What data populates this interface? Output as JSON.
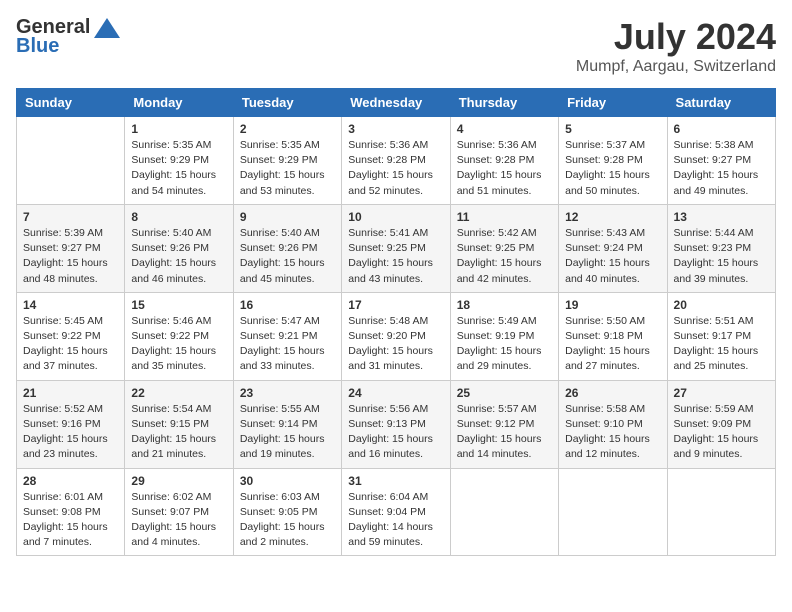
{
  "header": {
    "logo_general": "General",
    "logo_blue": "Blue",
    "month": "July 2024",
    "location": "Mumpf, Aargau, Switzerland"
  },
  "weekdays": [
    "Sunday",
    "Monday",
    "Tuesday",
    "Wednesday",
    "Thursday",
    "Friday",
    "Saturday"
  ],
  "weeks": [
    [
      {
        "day": "",
        "info": ""
      },
      {
        "day": "1",
        "info": "Sunrise: 5:35 AM\nSunset: 9:29 PM\nDaylight: 15 hours\nand 54 minutes."
      },
      {
        "day": "2",
        "info": "Sunrise: 5:35 AM\nSunset: 9:29 PM\nDaylight: 15 hours\nand 53 minutes."
      },
      {
        "day": "3",
        "info": "Sunrise: 5:36 AM\nSunset: 9:28 PM\nDaylight: 15 hours\nand 52 minutes."
      },
      {
        "day": "4",
        "info": "Sunrise: 5:36 AM\nSunset: 9:28 PM\nDaylight: 15 hours\nand 51 minutes."
      },
      {
        "day": "5",
        "info": "Sunrise: 5:37 AM\nSunset: 9:28 PM\nDaylight: 15 hours\nand 50 minutes."
      },
      {
        "day": "6",
        "info": "Sunrise: 5:38 AM\nSunset: 9:27 PM\nDaylight: 15 hours\nand 49 minutes."
      }
    ],
    [
      {
        "day": "7",
        "info": "Sunrise: 5:39 AM\nSunset: 9:27 PM\nDaylight: 15 hours\nand 48 minutes."
      },
      {
        "day": "8",
        "info": "Sunrise: 5:40 AM\nSunset: 9:26 PM\nDaylight: 15 hours\nand 46 minutes."
      },
      {
        "day": "9",
        "info": "Sunrise: 5:40 AM\nSunset: 9:26 PM\nDaylight: 15 hours\nand 45 minutes."
      },
      {
        "day": "10",
        "info": "Sunrise: 5:41 AM\nSunset: 9:25 PM\nDaylight: 15 hours\nand 43 minutes."
      },
      {
        "day": "11",
        "info": "Sunrise: 5:42 AM\nSunset: 9:25 PM\nDaylight: 15 hours\nand 42 minutes."
      },
      {
        "day": "12",
        "info": "Sunrise: 5:43 AM\nSunset: 9:24 PM\nDaylight: 15 hours\nand 40 minutes."
      },
      {
        "day": "13",
        "info": "Sunrise: 5:44 AM\nSunset: 9:23 PM\nDaylight: 15 hours\nand 39 minutes."
      }
    ],
    [
      {
        "day": "14",
        "info": "Sunrise: 5:45 AM\nSunset: 9:22 PM\nDaylight: 15 hours\nand 37 minutes."
      },
      {
        "day": "15",
        "info": "Sunrise: 5:46 AM\nSunset: 9:22 PM\nDaylight: 15 hours\nand 35 minutes."
      },
      {
        "day": "16",
        "info": "Sunrise: 5:47 AM\nSunset: 9:21 PM\nDaylight: 15 hours\nand 33 minutes."
      },
      {
        "day": "17",
        "info": "Sunrise: 5:48 AM\nSunset: 9:20 PM\nDaylight: 15 hours\nand 31 minutes."
      },
      {
        "day": "18",
        "info": "Sunrise: 5:49 AM\nSunset: 9:19 PM\nDaylight: 15 hours\nand 29 minutes."
      },
      {
        "day": "19",
        "info": "Sunrise: 5:50 AM\nSunset: 9:18 PM\nDaylight: 15 hours\nand 27 minutes."
      },
      {
        "day": "20",
        "info": "Sunrise: 5:51 AM\nSunset: 9:17 PM\nDaylight: 15 hours\nand 25 minutes."
      }
    ],
    [
      {
        "day": "21",
        "info": "Sunrise: 5:52 AM\nSunset: 9:16 PM\nDaylight: 15 hours\nand 23 minutes."
      },
      {
        "day": "22",
        "info": "Sunrise: 5:54 AM\nSunset: 9:15 PM\nDaylight: 15 hours\nand 21 minutes."
      },
      {
        "day": "23",
        "info": "Sunrise: 5:55 AM\nSunset: 9:14 PM\nDaylight: 15 hours\nand 19 minutes."
      },
      {
        "day": "24",
        "info": "Sunrise: 5:56 AM\nSunset: 9:13 PM\nDaylight: 15 hours\nand 16 minutes."
      },
      {
        "day": "25",
        "info": "Sunrise: 5:57 AM\nSunset: 9:12 PM\nDaylight: 15 hours\nand 14 minutes."
      },
      {
        "day": "26",
        "info": "Sunrise: 5:58 AM\nSunset: 9:10 PM\nDaylight: 15 hours\nand 12 minutes."
      },
      {
        "day": "27",
        "info": "Sunrise: 5:59 AM\nSunset: 9:09 PM\nDaylight: 15 hours\nand 9 minutes."
      }
    ],
    [
      {
        "day": "28",
        "info": "Sunrise: 6:01 AM\nSunset: 9:08 PM\nDaylight: 15 hours\nand 7 minutes."
      },
      {
        "day": "29",
        "info": "Sunrise: 6:02 AM\nSunset: 9:07 PM\nDaylight: 15 hours\nand 4 minutes."
      },
      {
        "day": "30",
        "info": "Sunrise: 6:03 AM\nSunset: 9:05 PM\nDaylight: 15 hours\nand 2 minutes."
      },
      {
        "day": "31",
        "info": "Sunrise: 6:04 AM\nSunset: 9:04 PM\nDaylight: 14 hours\nand 59 minutes."
      },
      {
        "day": "",
        "info": ""
      },
      {
        "day": "",
        "info": ""
      },
      {
        "day": "",
        "info": ""
      }
    ]
  ]
}
